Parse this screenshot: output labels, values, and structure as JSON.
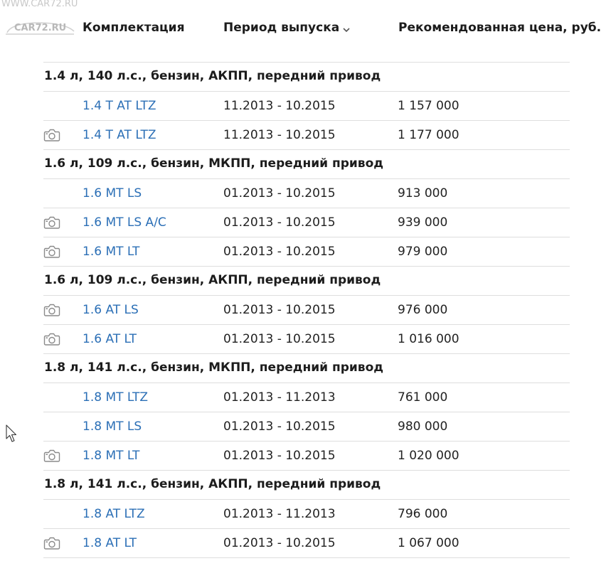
{
  "watermark": {
    "site_url": "WWW.CAR72.RU",
    "logo_text": "CAR72.RU"
  },
  "header": {
    "col_config": "Комплектация",
    "col_period": "Период выпуска",
    "col_price": "Рекомендованная цена, руб."
  },
  "groups": [
    {
      "title": "1.4 л, 140 л.с., бензин, АКПП, передний привод",
      "items": [
        {
          "trim": "1.4 T AT LTZ",
          "period": "11.2013 - 10.2015",
          "price": "1 157 000",
          "has_photo": false
        },
        {
          "trim": "1.4 T AT LTZ",
          "period": "11.2013 - 10.2015",
          "price": "1 177 000",
          "has_photo": true
        }
      ]
    },
    {
      "title": "1.6 л, 109 л.с., бензин, МКПП, передний привод",
      "items": [
        {
          "trim": "1.6 MT LS",
          "period": "01.2013 - 10.2015",
          "price": "913 000",
          "has_photo": false
        },
        {
          "trim": "1.6 MT LS A/C",
          "period": "01.2013 - 10.2015",
          "price": "939 000",
          "has_photo": true
        },
        {
          "trim": "1.6 MT LT",
          "period": "01.2013 - 10.2015",
          "price": "979 000",
          "has_photo": true
        }
      ]
    },
    {
      "title": "1.6 л, 109 л.с., бензин, АКПП, передний привод",
      "items": [
        {
          "trim": "1.6 AT LS",
          "period": "01.2013 - 10.2015",
          "price": "976 000",
          "has_photo": true
        },
        {
          "trim": "1.6 AT LT",
          "period": "01.2013 - 10.2015",
          "price": "1 016 000",
          "has_photo": true
        }
      ]
    },
    {
      "title": "1.8 л, 141 л.с., бензин, МКПП, передний привод",
      "items": [
        {
          "trim": "1.8 MT LTZ",
          "period": "01.2013 - 11.2013",
          "price": "761 000",
          "has_photo": false
        },
        {
          "trim": "1.8 MT LS",
          "period": "01.2013 - 10.2015",
          "price": "980 000",
          "has_photo": false
        },
        {
          "trim": "1.8 MT LT",
          "period": "01.2013 - 10.2015",
          "price": "1 020 000",
          "has_photo": true
        }
      ]
    },
    {
      "title": "1.8 л, 141 л.с., бензин, АКПП, передний привод",
      "items": [
        {
          "trim": "1.8 AT LTZ",
          "period": "01.2013 - 11.2013",
          "price": "796 000",
          "has_photo": false
        },
        {
          "trim": "1.8 AT LT",
          "period": "01.2013 - 10.2015",
          "price": "1 067 000",
          "has_photo": true
        }
      ]
    }
  ],
  "icons": {
    "photo": "camera-icon",
    "sort": "chevron-down-icon",
    "pointer": "mouse-cursor-icon"
  },
  "colors": {
    "link": "#2b6fb6",
    "text": "#222222",
    "rule": "#dedede",
    "icon": "#8a8a8a",
    "watermark": "#c4c4c4"
  }
}
